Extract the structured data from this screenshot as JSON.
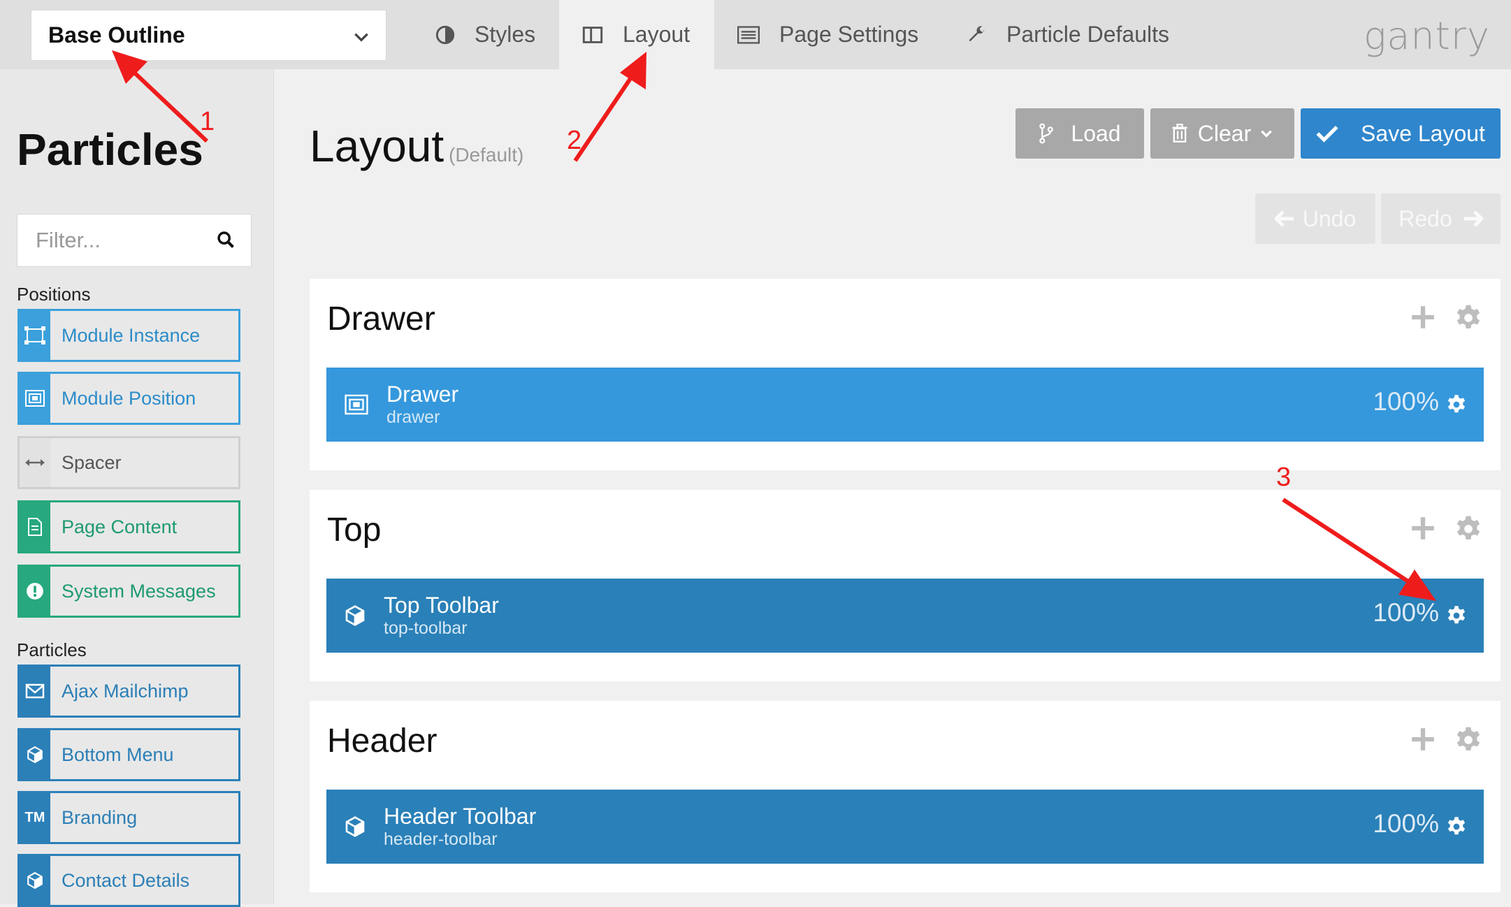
{
  "header": {
    "outline_select": "Base Outline",
    "tabs": [
      {
        "label": "Styles",
        "icon": "contrast-icon"
      },
      {
        "label": "Layout",
        "icon": "columns-icon"
      },
      {
        "label": "Page Settings",
        "icon": "list-icon"
      },
      {
        "label": "Particle Defaults",
        "icon": "wrench-icon"
      }
    ],
    "active_tab": "Layout",
    "brand": "gantry"
  },
  "sidebar": {
    "title": "Particles",
    "filter_placeholder": "Filter...",
    "positions_label": "Positions",
    "positions": [
      {
        "label": "Module Instance",
        "icon": "module-instance-icon"
      },
      {
        "label": "Module Position",
        "icon": "module-position-icon"
      },
      {
        "label": "Spacer",
        "icon": "spacer-icon"
      },
      {
        "label": "Page Content",
        "icon": "document-icon"
      },
      {
        "label": "System Messages",
        "icon": "exclamation-icon"
      }
    ],
    "particles_label": "Particles",
    "particles": [
      {
        "label": "Ajax Mailchimp",
        "icon": "envelope-icon"
      },
      {
        "label": "Bottom Menu",
        "icon": "cube-icon"
      },
      {
        "label": "Branding",
        "icon": "trademark-icon",
        "glyph": "TM"
      },
      {
        "label": "Contact Details",
        "icon": "cube-icon"
      }
    ]
  },
  "main": {
    "title": "Layout",
    "subtitle": "(Default)",
    "buttons": {
      "load": "Load",
      "clear": "Clear",
      "save": "Save Layout",
      "undo": "Undo",
      "redo": "Redo"
    },
    "sections": [
      {
        "title": "Drawer",
        "block": {
          "title": "Drawer",
          "key": "drawer",
          "size": "100%",
          "icon": "module-position-icon"
        }
      },
      {
        "title": "Top",
        "block": {
          "title": "Top Toolbar",
          "key": "top-toolbar",
          "size": "100%",
          "icon": "cube-icon"
        }
      },
      {
        "title": "Header",
        "block": {
          "title": "Header Toolbar",
          "key": "header-toolbar",
          "size": "100%",
          "icon": "cube-icon"
        }
      }
    ]
  },
  "annotations": {
    "one": "1",
    "two": "2",
    "three": "3",
    "color": "#ef1c1c"
  },
  "colors": {
    "accent_blue": "#2f86cc",
    "block_light": "#3598dc",
    "block_dark": "#2a80b8",
    "green": "#27a87f"
  }
}
